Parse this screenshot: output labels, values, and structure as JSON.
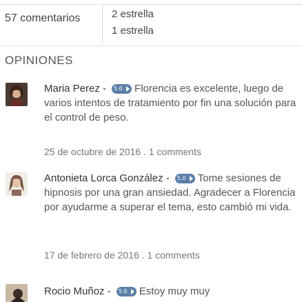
{
  "summary": {
    "comments_count": "57 comentarios",
    "ratings": [
      "2 estrella",
      "1 estrella"
    ]
  },
  "section_title": "OPINIONES",
  "reviews": [
    {
      "author": "Maria Perez -",
      "badge": "5.0",
      "text_lead": "Florencia es excelente,",
      "text_rest": "luego de varios intentos de tratamiento por fin una solución para el control de peso.",
      "meta": "25 de octubre de 2016 . 1 comments",
      "avatar_color": "#6b4a3a"
    },
    {
      "author": "Antonieta Lorca González -",
      "badge": "5.0",
      "text_lead": "Tome",
      "text_rest": "sesiones de hipnosis por una gran ansiedad. Agradecer a Florencia por ayudarme a superar el tema, esto cambió mi vida.",
      "meta": "17 de febrero de 2016 . 1 comments",
      "avatar_color": "#a08070"
    },
    {
      "author": "Rocio Muñoz -",
      "badge": "5.0",
      "text_lead": "Estoy muy muy",
      "text_rest": "",
      "meta": "",
      "avatar_color": "#8a7058"
    }
  ],
  "colors": {
    "badge": "#5b7fa8",
    "divider": "#d9d9d9"
  }
}
